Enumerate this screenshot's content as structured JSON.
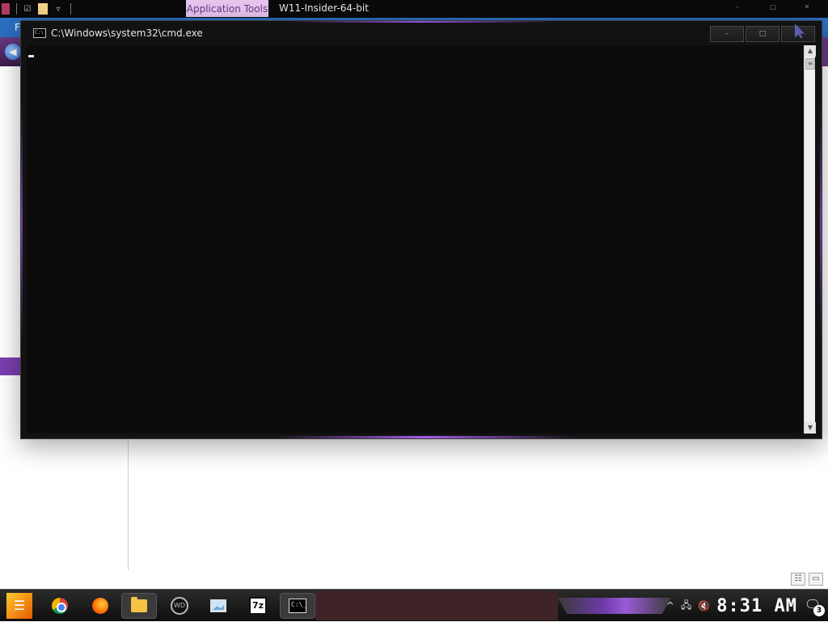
{
  "explorer": {
    "tab_label": "Application Tools",
    "title": "W11-Insider-64-bit",
    "ribbon_file": "F",
    "minimize": "–",
    "maximize": "□",
    "close": "✕"
  },
  "cmd": {
    "title": "C:\\Windows\\system32\\cmd.exe",
    "minimize": "–",
    "maximize": "□",
    "close": "✕"
  },
  "taskbar": {
    "apps": [
      {
        "name": "chrome-icon"
      },
      {
        "name": "firefox-icon"
      },
      {
        "name": "folder-icon"
      },
      {
        "name": "wd-app-icon"
      },
      {
        "name": "image-viewer-icon"
      },
      {
        "name": "7zip-icon",
        "label": "7z"
      },
      {
        "name": "cmd-icon",
        "label": "C:\\_"
      }
    ],
    "clock": "8:31 AM",
    "notification_count": "3"
  },
  "colors": {
    "accent": "#7b3fb0",
    "cmd_bg": "#0c0c0c",
    "tab_bg": "#e6c6ef"
  }
}
